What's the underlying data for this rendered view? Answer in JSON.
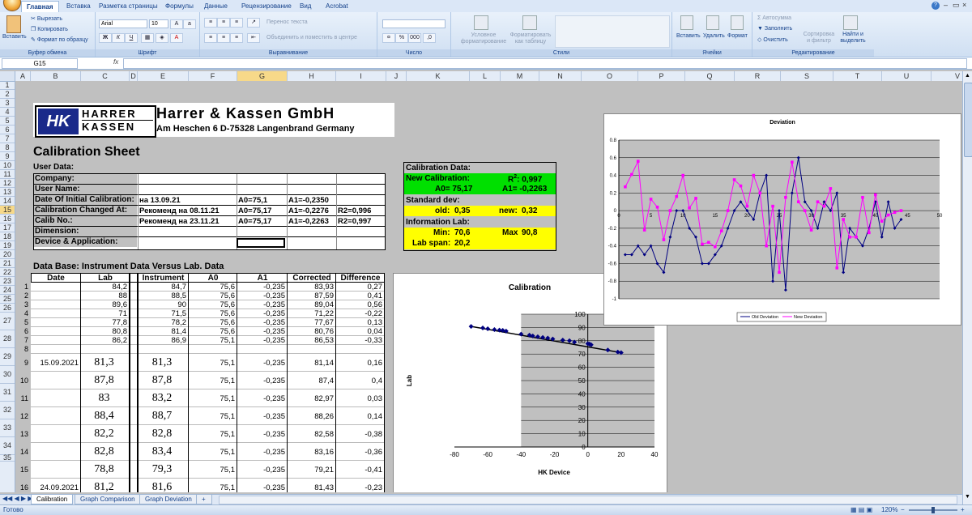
{
  "ribbon": {
    "office_btn": "",
    "tabs": [
      "Главная",
      "Вставка",
      "Разметка страницы",
      "Формулы",
      "Данные",
      "Рецензирование",
      "Вид",
      "Acrobat"
    ],
    "clipboard": {
      "paste": "Вставить",
      "cut": "Вырезать",
      "copy": "Копировать",
      "format_painter": "Формат по образцу",
      "label": "Буфер обмена"
    },
    "font": {
      "name": "Arial",
      "size": "10",
      "bold": "Ж",
      "italic": "К",
      "underline": "Ч",
      "label": "Шрифт"
    },
    "align": {
      "wrap": "Перенос текста",
      "merge": "Объединить и поместить в центре",
      "label": "Выравнивание"
    },
    "number": {
      "percent": "%",
      "thousands": "000",
      "label": "Число"
    },
    "styles": {
      "cond": "Условное форматирование",
      "table": "Форматировать как таблицу",
      "label": "Стили"
    },
    "cells": {
      "insert": "Вставить",
      "delete": "Удалить",
      "format": "Формат",
      "label": "Ячейки"
    },
    "editing": {
      "autosum": "Автосумма",
      "fill": "Заполнить",
      "clear": "Очистить",
      "sort": "Сортировка и фильтр",
      "find": "Найти и выделить",
      "label": "Редактирование"
    }
  },
  "formula": {
    "namebox": "G15",
    "fx": "fx",
    "value": ""
  },
  "columns": [
    "A",
    "B",
    "C",
    "D",
    "E",
    "F",
    "G",
    "H",
    "I",
    "J",
    "K",
    "L",
    "M",
    "N",
    "O",
    "P",
    "Q",
    "R",
    "S",
    "T",
    "U",
    "V"
  ],
  "rows": [
    "1",
    "2",
    "3",
    "4",
    "5",
    "6",
    "7",
    "8",
    "9",
    "10",
    "11",
    "12",
    "13",
    "14",
    "15",
    "16",
    "17",
    "18",
    "19",
    "20",
    "21",
    "22",
    "23",
    "24",
    "25",
    "26",
    "27",
    "28",
    "29",
    "30",
    "31",
    "32",
    "33",
    "34",
    "35"
  ],
  "header": {
    "logo_top": "HARRER",
    "logo_bottom": "KASSEN",
    "logo_mark": "HK",
    "company": "Harrer & Kassen GmbH",
    "address": "Am Heschen 6   D-75328 Langenbrand  Germany",
    "title": "Calibration Sheet",
    "user_data": "User Data:"
  },
  "info": [
    {
      "label": "Company:",
      "b": "",
      "c": "",
      "d": "",
      "e": ""
    },
    {
      "label": "User Name:",
      "b": "",
      "c": "",
      "d": "",
      "e": ""
    },
    {
      "label": "Date Of Initial Calibration:",
      "b": "на 13.09.21",
      "c": "A0=75,1",
      "d": "A1=-0,2350",
      "e": ""
    },
    {
      "label": "Calibration Changed At:",
      "b": "Рекоменд на 08.11.21",
      "c": "A0=75,17",
      "d": "A1=-0,2276",
      "e": "R2=0,996"
    },
    {
      "label": "Calib No.:",
      "b": "Рекоменд на 23.11.21",
      "c": "A0=75,17",
      "d": "A1=-0,2263",
      "e": "R2=0,997"
    },
    {
      "label": "Dimension:",
      "b": "",
      "c": "",
      "d": "",
      "e": ""
    },
    {
      "label": "Device & Application:",
      "b": "",
      "c": "",
      "d": "",
      "e": ""
    }
  ],
  "calib": {
    "title": "Calibration Data:",
    "new_cal": "New Calibration:",
    "r2_label": "R",
    "r2_sup": "2",
    "r2_value": ": 0,997",
    "a0": "A0= 75,17",
    "a1": "A1= -0,2263",
    "std_title": "Standard dev:",
    "old_label": "old:",
    "old": "0,35",
    "new_label": "new:",
    "new": "0,32",
    "info_title": "Information Lab:",
    "min_label": "Min:",
    "min": "70,6",
    "max_label": "Max",
    "max": "90,8",
    "span_label": "Lab span:",
    "span": "20,2"
  },
  "db": {
    "title": "Data Base: Instrument Data Versus Lab. Data",
    "headers": [
      "Date",
      "Lab",
      "Instrument",
      "A0",
      "A1",
      "Corrected",
      "Difference"
    ],
    "rows": [
      {
        "n": "1",
        "date": "",
        "lab": "84,2",
        "ins": "84,7",
        "a0": "75,6",
        "a1": "-0,235",
        "cor": "83,93",
        "diff": "0,27"
      },
      {
        "n": "2",
        "date": "",
        "lab": "88",
        "ins": "88,5",
        "a0": "75,6",
        "a1": "-0,235",
        "cor": "87,59",
        "diff": "0,41"
      },
      {
        "n": "3",
        "date": "",
        "lab": "89,6",
        "ins": "90",
        "a0": "75,6",
        "a1": "-0,235",
        "cor": "89,04",
        "diff": "0,56"
      },
      {
        "n": "4",
        "date": "",
        "lab": "71",
        "ins": "71,5",
        "a0": "75,6",
        "a1": "-0,235",
        "cor": "71,22",
        "diff": "-0,22"
      },
      {
        "n": "5",
        "date": "",
        "lab": "77,8",
        "ins": "78,2",
        "a0": "75,6",
        "a1": "-0,235",
        "cor": "77,67",
        "diff": "0,13"
      },
      {
        "n": "6",
        "date": "",
        "lab": "80,8",
        "ins": "81,4",
        "a0": "75,6",
        "a1": "-0,235",
        "cor": "80,76",
        "diff": "0,04"
      },
      {
        "n": "7",
        "date": "",
        "lab": "86,2",
        "ins": "86,9",
        "a0": "75,1",
        "a1": "-0,235",
        "cor": "86,53",
        "diff": "-0,33"
      },
      {
        "n": "8",
        "date": "",
        "lab": "",
        "ins": "",
        "a0": "",
        "a1": "",
        "cor": "",
        "diff": ""
      },
      {
        "n": "9",
        "date": "15.09.2021",
        "lab": "81,3",
        "ins": "81,3",
        "a0": "75,1",
        "a1": "-0,235",
        "cor": "81,14",
        "diff": "0,16"
      },
      {
        "n": "10",
        "date": "",
        "lab": "87,8",
        "ins": "87,8",
        "a0": "75,1",
        "a1": "-0,235",
        "cor": "87,4",
        "diff": "0,4"
      },
      {
        "n": "11",
        "date": "",
        "lab": "83",
        "ins": "83,2",
        "a0": "75,1",
        "a1": "-0,235",
        "cor": "82,97",
        "diff": "0,03"
      },
      {
        "n": "12",
        "date": "",
        "lab": "88,4",
        "ins": "88,7",
        "a0": "75,1",
        "a1": "-0,235",
        "cor": "88,26",
        "diff": "0,14"
      },
      {
        "n": "13",
        "date": "",
        "lab": "82,2",
        "ins": "82,8",
        "a0": "75,1",
        "a1": "-0,235",
        "cor": "82,58",
        "diff": "-0,38"
      },
      {
        "n": "14",
        "date": "",
        "lab": "82,8",
        "ins": "83,4",
        "a0": "75,1",
        "a1": "-0,235",
        "cor": "83,16",
        "diff": "-0,36"
      },
      {
        "n": "15",
        "date": "",
        "lab": "78,8",
        "ins": "79,3",
        "a0": "75,1",
        "a1": "-0,235",
        "cor": "79,21",
        "diff": "-0,41"
      },
      {
        "n": "16",
        "date": "24.09.2021",
        "lab": "81,2",
        "ins": "81,6",
        "a0": "75,1",
        "a1": "-0,235",
        "cor": "81,43",
        "diff": "-0,23"
      }
    ]
  },
  "sheet_tabs": [
    "Calibration",
    "Graph Comparison",
    "Graph Deviation"
  ],
  "status": {
    "ready": "Готово",
    "zoom": "120%"
  },
  "chart_data": [
    {
      "type": "scatter",
      "title": "Calibration",
      "xlabel": "HK Device",
      "ylabel": "Lab",
      "xlim": [
        -80,
        40
      ],
      "ylim": [
        0,
        100
      ],
      "xticks": [
        -80,
        -60,
        -40,
        -20,
        0,
        20,
        40
      ],
      "yticks": [
        0,
        10,
        20,
        30,
        40,
        50,
        60,
        70,
        80,
        90,
        100
      ],
      "grid": true,
      "x": [
        -70,
        -63,
        -60,
        -56,
        -53,
        -51,
        -49,
        -40,
        -35,
        -33,
        -30,
        -27,
        -24,
        -21,
        -15,
        -11,
        -8,
        0,
        1,
        2,
        12,
        18,
        20
      ],
      "y": [
        90.8,
        89.6,
        89,
        88.4,
        88,
        87.8,
        87.3,
        85,
        84.2,
        83.6,
        83,
        82.5,
        82,
        81.3,
        80.5,
        80,
        79,
        77.8,
        77.5,
        77,
        73,
        71.5,
        71
      ],
      "trend": {
        "x": [
          -70,
          20
        ],
        "y": [
          90.8,
          71
        ]
      }
    },
    {
      "type": "line",
      "title": "Deviation",
      "xlim": [
        0,
        50
      ],
      "ylim": [
        -1,
        0.8
      ],
      "xticks": [
        0,
        5,
        10,
        15,
        20,
        25,
        30,
        35,
        40,
        45,
        50
      ],
      "yticks": [
        -1,
        -0.8,
        -0.6,
        -0.4,
        -0.2,
        0,
        0.2,
        0.4,
        0.6,
        0.8
      ],
      "legend_position": "bottom",
      "series": [
        {
          "name": "Old Deviation",
          "color": "#000080",
          "x": [
            1,
            2,
            3,
            4,
            5,
            6,
            7,
            8,
            9,
            10,
            11,
            12,
            13,
            14,
            15,
            16,
            17,
            18,
            19,
            20,
            21,
            22,
            23,
            24,
            25,
            26,
            27,
            28,
            29,
            30,
            31,
            32,
            33,
            34,
            35,
            36,
            37,
            38,
            39,
            40,
            41,
            42,
            43,
            44
          ],
          "y": [
            -0.5,
            -0.5,
            -0.4,
            -0.5,
            -0.4,
            -0.6,
            -0.7,
            -0.3,
            0,
            0,
            -0.2,
            -0.3,
            -0.6,
            -0.6,
            -0.5,
            -0.4,
            -0.2,
            0,
            0.1,
            0,
            -0.1,
            0.2,
            0.4,
            -0.8,
            0,
            -0.9,
            0.2,
            0.6,
            0.1,
            0,
            -0.2,
            0.1,
            0,
            0.2,
            -0.7,
            -0.2,
            -0.3,
            -0.4,
            -0.2,
            0.1,
            -0.3,
            0.1,
            -0.2,
            -0.1
          ]
        },
        {
          "name": "New Deviation",
          "color": "#ff00ff",
          "x": [
            1,
            2,
            3,
            4,
            5,
            6,
            7,
            8,
            9,
            10,
            11,
            12,
            13,
            14,
            15,
            16,
            17,
            18,
            19,
            20,
            21,
            22,
            23,
            24,
            25,
            26,
            27,
            28,
            29,
            30,
            31,
            32,
            33,
            34,
            35,
            36,
            37,
            38,
            39,
            40,
            41,
            42,
            43,
            44
          ],
          "y": [
            0.27,
            0.41,
            0.56,
            -0.22,
            0.13,
            0.04,
            -0.33,
            0,
            0.16,
            0.4,
            0.03,
            0.14,
            -0.38,
            -0.36,
            -0.41,
            -0.23,
            0,
            0.35,
            0.28,
            0.05,
            0.4,
            0.2,
            -0.4,
            0.05,
            -0.7,
            0.15,
            0.55,
            0.1,
            0,
            -0.22,
            0.1,
            0.05,
            0.25,
            -0.65,
            -0.1,
            -0.3,
            -0.3,
            0.15,
            -0.25,
            0.18,
            -0.12,
            -0.05,
            -0.02,
            0.0
          ]
        }
      ]
    }
  ]
}
